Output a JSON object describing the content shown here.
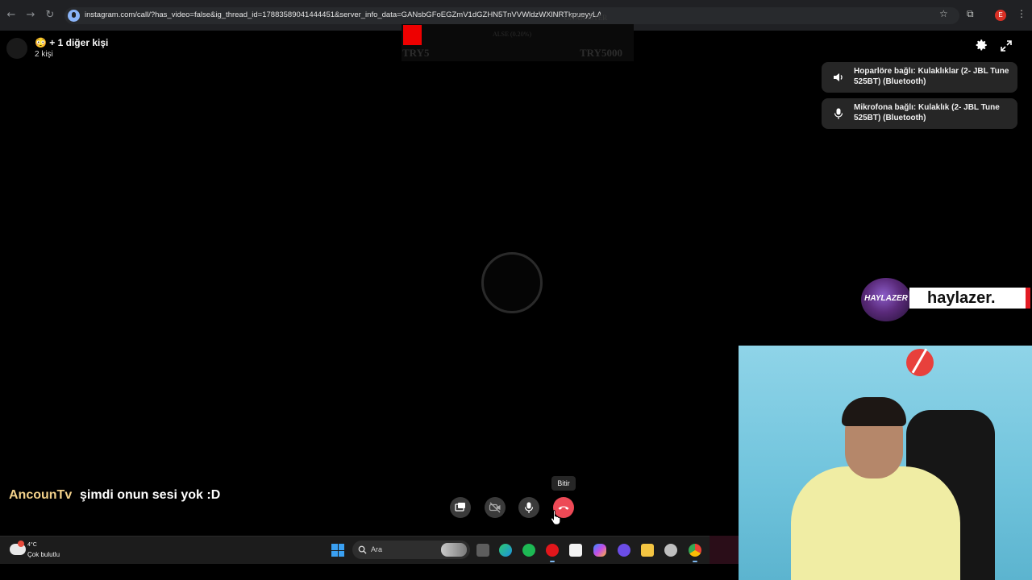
{
  "browser": {
    "url": "instagram.com/call/?has_video=false&ig_thread_id=17883589041444451&server_info_data=GANsbGFoEGZmV1dGZHN5TnVVWldzWXlNRTkpueyyLA"
  },
  "stream_overlay": {
    "line1": "ONAK İSTER",
    "line2": "ALSE (0.20%)",
    "left_amount": "TRY5",
    "right_amount": "TRY5000"
  },
  "call": {
    "title_emoji": "😳",
    "title": "+ 1 diğer kişi",
    "subtitle": "2 kişi",
    "end_tooltip": "Bitir",
    "devices": [
      {
        "icon": "speaker-icon",
        "text": "Hoparlöre bağlı: Kulaklıklar (2- JBL Tune 525BT) (Bluetooth)"
      },
      {
        "icon": "microphone-icon",
        "text": "Mikrofona bağlı: Kulaklık (2- JBL Tune 525BT) (Bluetooth)"
      }
    ]
  },
  "streamer": {
    "logo_text": "HAYLAZER",
    "name": "haylazer."
  },
  "chat": {
    "user": "AncounTv",
    "message": "şimdi onun sesi yok :D"
  },
  "taskbar": {
    "temperature": "4°C",
    "condition": "Çok bulutlu",
    "search_label": "Ara"
  },
  "colors": {
    "end_call": "#ed4956",
    "chat_user": "#f3d18a",
    "overlay_red": "#ee0000",
    "streamer_accent": "#e31b23"
  }
}
